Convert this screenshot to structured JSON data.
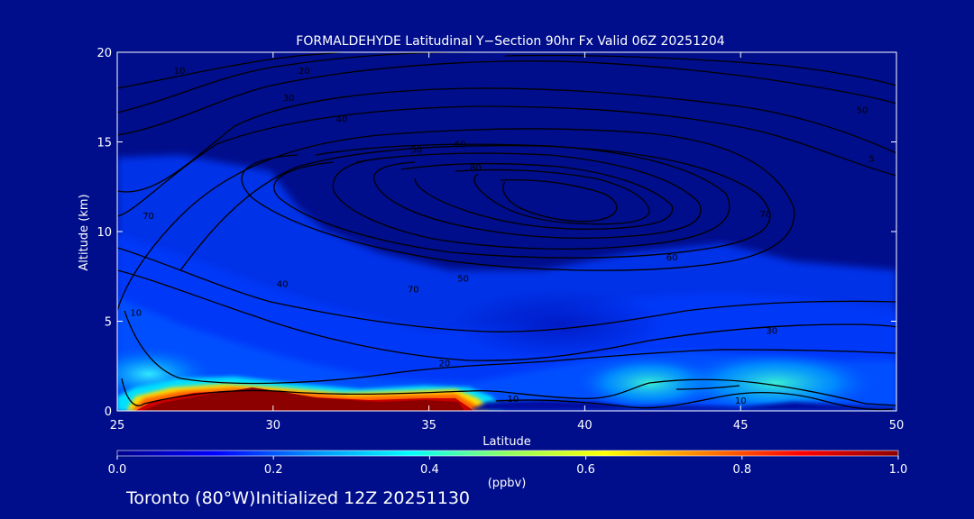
{
  "chart_data": {
    "type": "contour",
    "title": "FORMALDEHYDE Latitudinal Y−Section 90hr  Fx Valid 06Z 20251204",
    "xlabel": "Latitude",
    "ylabel": "Altitude (km)",
    "xlim": [
      25,
      50
    ],
    "ylim": [
      0,
      20
    ],
    "x_ticks": [
      25,
      30,
      35,
      40,
      45,
      50
    ],
    "y_ticks": [
      0,
      5,
      10,
      15,
      20
    ],
    "fill_field": {
      "quantity": "FORMALDEHYDE",
      "units": "(ppbv)",
      "range": [
        0.0,
        1.0
      ],
      "high_regions": [
        {
          "lat_range": [
            25.5,
            35.5
          ],
          "alt_range": [
            0,
            1.3
          ],
          "value": 1.0
        },
        {
          "lat_range": [
            35.5,
            37
          ],
          "alt_range": [
            0,
            0.9
          ],
          "value": 0.7
        },
        {
          "lat_range": [
            41,
            49
          ],
          "alt_range": [
            0,
            2.5
          ],
          "value": 0.35
        }
      ]
    },
    "colorbar": {
      "ticks": [
        "0.0",
        "0.2",
        "0.4",
        "0.6",
        "0.8",
        "1.0"
      ],
      "units": "(ppbv)",
      "colors": [
        "#00008c",
        "#0000ff",
        "#0090ff",
        "#00ffff",
        "#90ff60",
        "#ffff00",
        "#ff8000",
        "#ff0000",
        "#8c0000"
      ]
    },
    "contour_labels": [
      {
        "text": "10",
        "lat": 27,
        "alt": 19
      },
      {
        "text": "20",
        "lat": 31,
        "alt": 19
      },
      {
        "text": "30",
        "lat": 30.5,
        "alt": 17.5
      },
      {
        "text": "40",
        "lat": 32.2,
        "alt": 16.3
      },
      {
        "text": "50",
        "lat": 34.6,
        "alt": 14.6
      },
      {
        "text": "60",
        "lat": 36,
        "alt": 14.9
      },
      {
        "text": "80",
        "lat": 36.5,
        "alt": 13.6
      },
      {
        "text": "70",
        "lat": 26,
        "alt": 10.9
      },
      {
        "text": "40",
        "lat": 30.3,
        "alt": 7.1
      },
      {
        "text": "10",
        "lat": 25.6,
        "alt": 5.5
      },
      {
        "text": "70",
        "lat": 34.5,
        "alt": 6.8
      },
      {
        "text": "50",
        "lat": 36.1,
        "alt": 7.4
      },
      {
        "text": "60",
        "lat": 42.8,
        "alt": 8.6
      },
      {
        "text": "70",
        "lat": 45.8,
        "alt": 11
      },
      {
        "text": "50",
        "lat": 48.9,
        "alt": 16.8
      },
      {
        "text": "5",
        "lat": 49.2,
        "alt": 14.1
      },
      {
        "text": "30",
        "lat": 46,
        "alt": 4.5
      },
      {
        "text": "20",
        "lat": 35.5,
        "alt": 2.7
      },
      {
        "text": "10",
        "lat": 37.7,
        "alt": 0.7
      },
      {
        "text": "10",
        "lat": 45,
        "alt": 0.6
      }
    ]
  },
  "footer": {
    "location_text": "Toronto (80°W)Initialized 12Z 20251130"
  }
}
